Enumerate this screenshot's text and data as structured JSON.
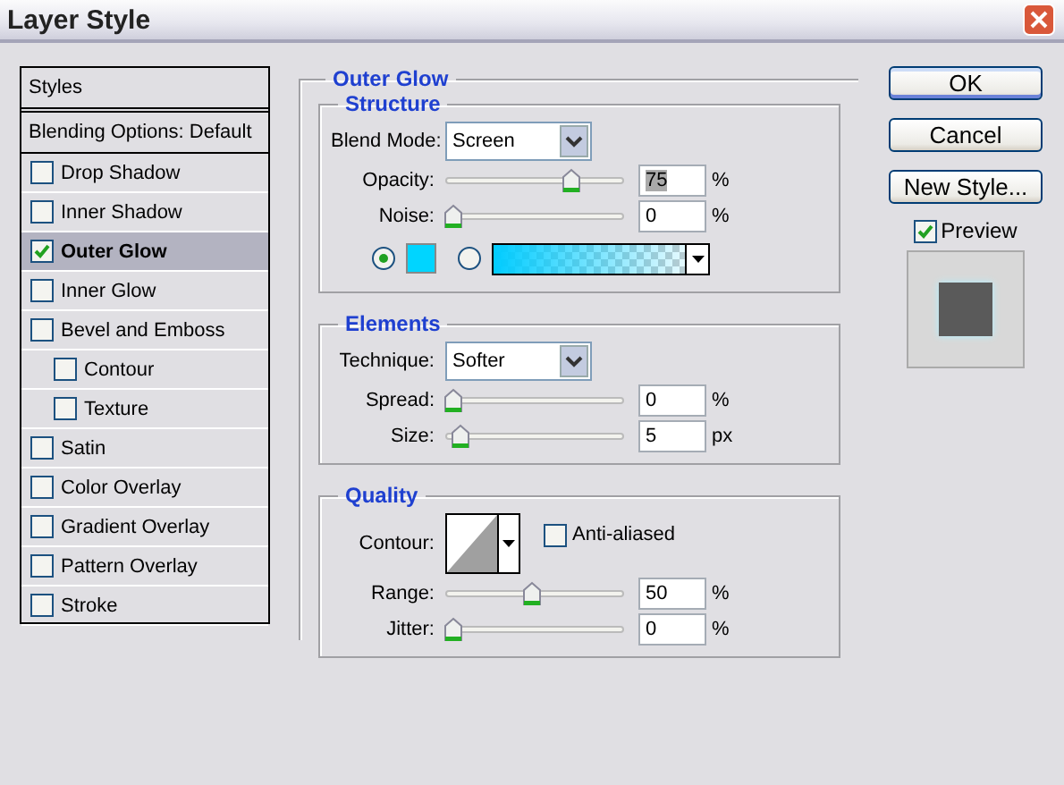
{
  "window": {
    "title": "Layer Style"
  },
  "styles_list": {
    "header": "Styles",
    "items": [
      {
        "kind": "header",
        "label": "Blending Options: Default",
        "selected": false
      },
      {
        "kind": "check",
        "label": "Drop Shadow",
        "checked": false,
        "selected": false
      },
      {
        "kind": "check",
        "label": "Inner Shadow",
        "checked": false,
        "selected": false
      },
      {
        "kind": "check",
        "label": "Outer Glow",
        "checked": true,
        "selected": true
      },
      {
        "kind": "check",
        "label": "Inner Glow",
        "checked": false,
        "selected": false
      },
      {
        "kind": "check",
        "label": "Bevel and Emboss",
        "checked": false,
        "selected": false,
        "children": [
          {
            "kind": "check",
            "label": "Contour",
            "checked": false,
            "selected": false
          },
          {
            "kind": "check",
            "label": "Texture",
            "checked": false,
            "selected": false
          }
        ]
      },
      {
        "kind": "check",
        "label": "Satin",
        "checked": false,
        "selected": false
      },
      {
        "kind": "check",
        "label": "Color Overlay",
        "checked": false,
        "selected": false
      },
      {
        "kind": "check",
        "label": "Gradient Overlay",
        "checked": false,
        "selected": false
      },
      {
        "kind": "check",
        "label": "Pattern Overlay",
        "checked": false,
        "selected": false
      },
      {
        "kind": "check",
        "label": "Stroke",
        "checked": false,
        "selected": false
      }
    ]
  },
  "panel": {
    "title": "Outer Glow",
    "groups": [
      {
        "title": "Structure",
        "rows": [
          {
            "kind": "dropdown",
            "label": "Blend Mode:",
            "value": "Screen"
          },
          {
            "kind": "slider",
            "label": "Opacity:",
            "level": 0.75,
            "value": "75",
            "unit": "%",
            "text_selected": true
          },
          {
            "kind": "slider",
            "label": "Noise:",
            "level": 0,
            "value": "0",
            "unit": "%",
            "text_selected": false
          },
          {
            "kind": "glow_source",
            "options": [
              {
                "kind": "solid",
                "selected": true
              },
              {
                "kind": "gradient",
                "selected": false
              }
            ]
          }
        ]
      },
      {
        "title": "Elements",
        "rows": [
          {
            "kind": "dropdown",
            "label": "Technique:",
            "value": "Softer"
          },
          {
            "kind": "slider",
            "label": "Spread:",
            "level": 0,
            "value": "0",
            "unit": "%",
            "text_selected": false
          },
          {
            "kind": "slider",
            "label": "Size:",
            "level": 0.05,
            "value": "5",
            "unit": "px",
            "text_selected": false
          }
        ]
      },
      {
        "title": "Quality",
        "rows": [
          {
            "kind": "contour",
            "label": "Contour:",
            "checkbox": {
              "label": "Anti-aliased",
              "checked": false
            }
          },
          {
            "kind": "slider",
            "label": "Range:",
            "level": 0.5,
            "value": "50",
            "unit": "%",
            "text_selected": false
          },
          {
            "kind": "slider",
            "label": "Jitter:",
            "level": 0,
            "value": "0",
            "unit": "%",
            "text_selected": false
          }
        ]
      }
    ]
  },
  "buttons": [
    {
      "label": "OK",
      "default": true
    },
    {
      "label": "Cancel",
      "default": false
    },
    {
      "label": "New Style...",
      "default": false
    }
  ],
  "preview": {
    "label": "Preview",
    "checked": true
  }
}
